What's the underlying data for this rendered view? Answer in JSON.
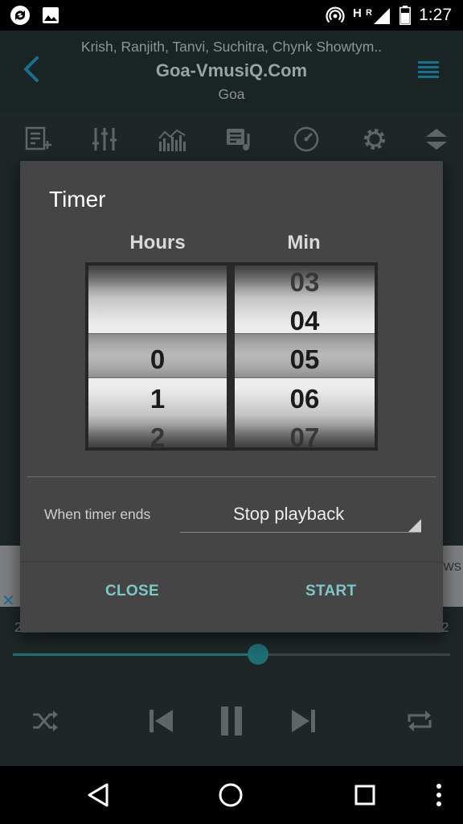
{
  "status_bar": {
    "time": "1:27",
    "network_letter": "H",
    "roaming_letter": "R",
    "icons": [
      "sync-icon",
      "image-icon",
      "hotspot-icon",
      "signal-icon",
      "battery-icon"
    ]
  },
  "player": {
    "artists": "Krish, Ranjith, Tanvi, Suchitra, Chynk Showtym..",
    "title": "Goa-VmusiQ.Com",
    "album": "Goa",
    "toolbar_icons": [
      "add-to-playlist-icon",
      "equalizer-icon",
      "visualizer-icon",
      "lyrics-icon",
      "sleep-timer-icon",
      "settings-icon",
      "collapse-icon"
    ],
    "ad_fragment": "WS",
    "elapsed_fragment": "2",
    "total_fragment": "2",
    "progress": 0.56,
    "controls": [
      "shuffle-icon",
      "previous-icon",
      "pause-icon",
      "next-icon",
      "repeat-icon"
    ]
  },
  "dialog": {
    "title": "Timer",
    "hours_header": "Hours",
    "min_header": "Min",
    "hours_items": [
      "",
      "",
      "0",
      "1",
      "2"
    ],
    "min_items": [
      "03",
      "04",
      "05",
      "06",
      "07"
    ],
    "when_label": "When timer ends",
    "end_action": "Stop playback",
    "close_label": "CLOSE",
    "start_label": "START"
  },
  "colors": {
    "accent": "#7ec6c8",
    "seek": "#1d6f74",
    "dialog_bg": "#454545"
  }
}
